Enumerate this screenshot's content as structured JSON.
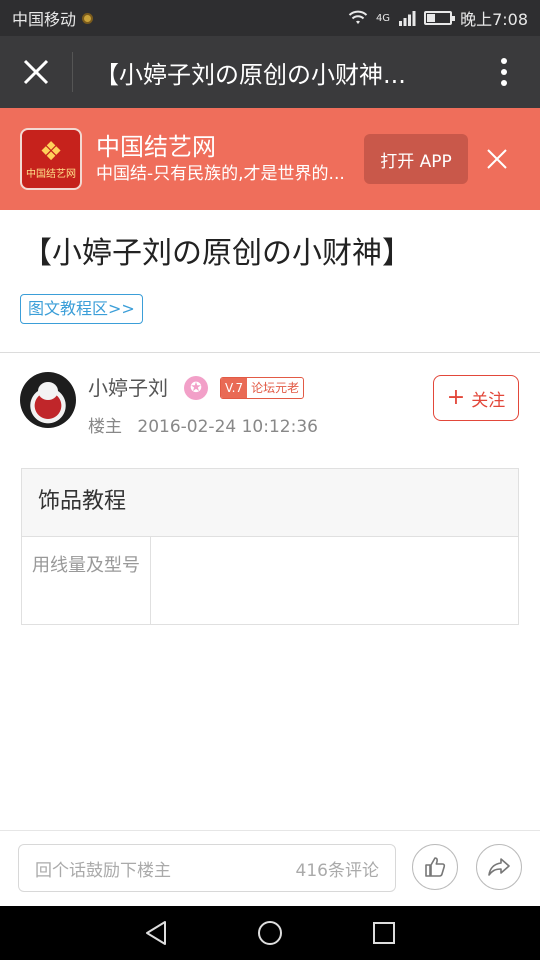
{
  "status_bar": {
    "carrier": "中国移动",
    "network": "4G",
    "time": "晚上7:08",
    "battery_level": 0.35
  },
  "nav": {
    "title": "【小婷子刘の原创の小财神..."
  },
  "app_banner": {
    "app_name": "中国结艺网",
    "logo_text": "中国结艺网",
    "description": "中国结-只有民族的,才是世界的...",
    "open_label": "打开 APP",
    "accent_color": "#ef6e5b"
  },
  "post": {
    "title": "【小婷子刘の原创の小财神】",
    "category_tag": "图文教程区>>"
  },
  "author": {
    "name": "小婷子刘",
    "level": "V.7",
    "rank": "论坛元老",
    "role": "楼主",
    "posted_at": "2016-02-24 10:12:36",
    "follow_label": "关注"
  },
  "spec_table": {
    "header": "饰品教程",
    "rows": [
      {
        "label": "用线量及型号",
        "value": ""
      }
    ]
  },
  "comment_bar": {
    "placeholder": "回个话鼓励下楼主",
    "comment_count": "416条评论"
  }
}
